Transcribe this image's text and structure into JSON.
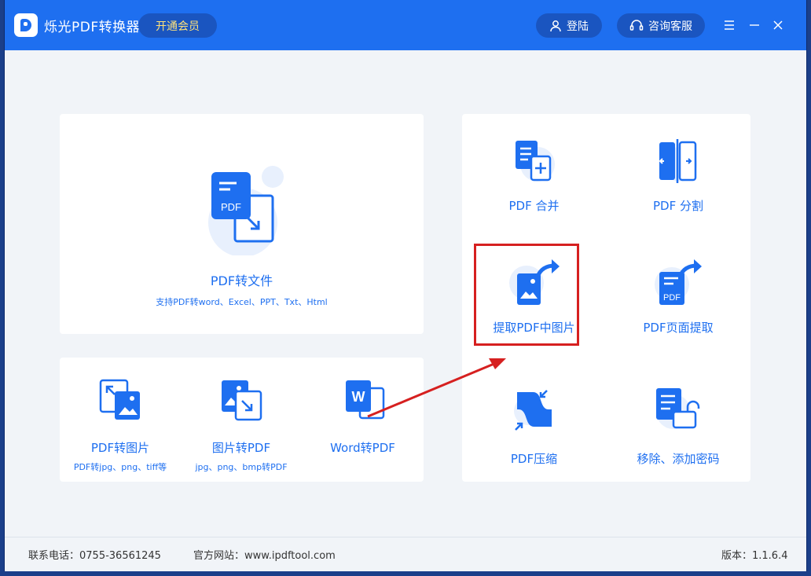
{
  "titlebar": {
    "app_title": "烁光PDF转换器",
    "vip_label": "开通会员",
    "login_label": "登陆",
    "service_label": "咨询客服"
  },
  "main": {
    "big_card": {
      "label": "PDF转文件",
      "sub": "支持PDF转word、Excel、PPT、Txt、Html"
    },
    "small_tools": [
      {
        "label": "PDF转图片",
        "sub": "PDF转jpg、png、tiff等"
      },
      {
        "label": "图片转PDF",
        "sub": "jpg、png、bmp转PDF"
      },
      {
        "label": "Word转PDF"
      }
    ],
    "right_tools": [
      {
        "label": "PDF 合并"
      },
      {
        "label": "PDF 分割"
      },
      {
        "label": "提取PDF中图片"
      },
      {
        "label": "PDF页面提取"
      },
      {
        "label": "PDF压缩"
      },
      {
        "label": "移除、添加密码"
      }
    ],
    "icon_texts": {
      "pdf": "PDF",
      "word": "W"
    }
  },
  "footer": {
    "phone": "联系电话：0755-36561245",
    "website": "官方网站：www.ipdftool.com",
    "version": "版本：1.1.6.4"
  },
  "colors": {
    "accent": "#1e6ff0",
    "highlight": "#d62020"
  }
}
